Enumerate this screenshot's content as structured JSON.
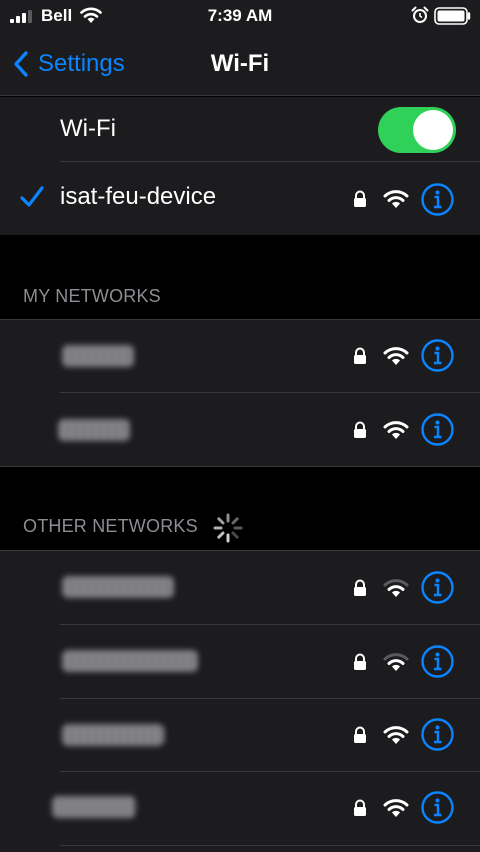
{
  "status_bar": {
    "carrier": "Bell",
    "time": "7:39 AM"
  },
  "nav": {
    "back_label": "Settings",
    "title": "Wi-Fi"
  },
  "wifi_toggle": {
    "label": "Wi-Fi",
    "on": true
  },
  "connected_network": {
    "name": "isat-feu-device",
    "secured": true
  },
  "my_networks": {
    "header": "MY NETWORKS",
    "items": [
      {
        "name": "",
        "secured": true,
        "signal": "full"
      },
      {
        "name": "",
        "secured": true,
        "signal": "full"
      }
    ]
  },
  "other_networks": {
    "header": "OTHER NETWORKS",
    "items": [
      {
        "name": "",
        "secured": true,
        "signal": "weak"
      },
      {
        "name": "",
        "secured": true,
        "signal": "weak"
      },
      {
        "name": "",
        "secured": true,
        "signal": "full"
      },
      {
        "name": "",
        "secured": true,
        "signal": "full"
      }
    ]
  },
  "colors": {
    "accent": "#0a84ff",
    "toggle_on": "#30d158",
    "background": "#000000",
    "cell": "#1c1c1e",
    "separator": "#38383a",
    "header_text": "#8d8d93"
  },
  "icons": [
    "signal-bars-icon",
    "wifi-icon",
    "alarm-clock-icon",
    "battery-icon",
    "chevron-left-icon",
    "checkmark-icon",
    "lock-icon",
    "info-icon",
    "spinner-icon"
  ]
}
